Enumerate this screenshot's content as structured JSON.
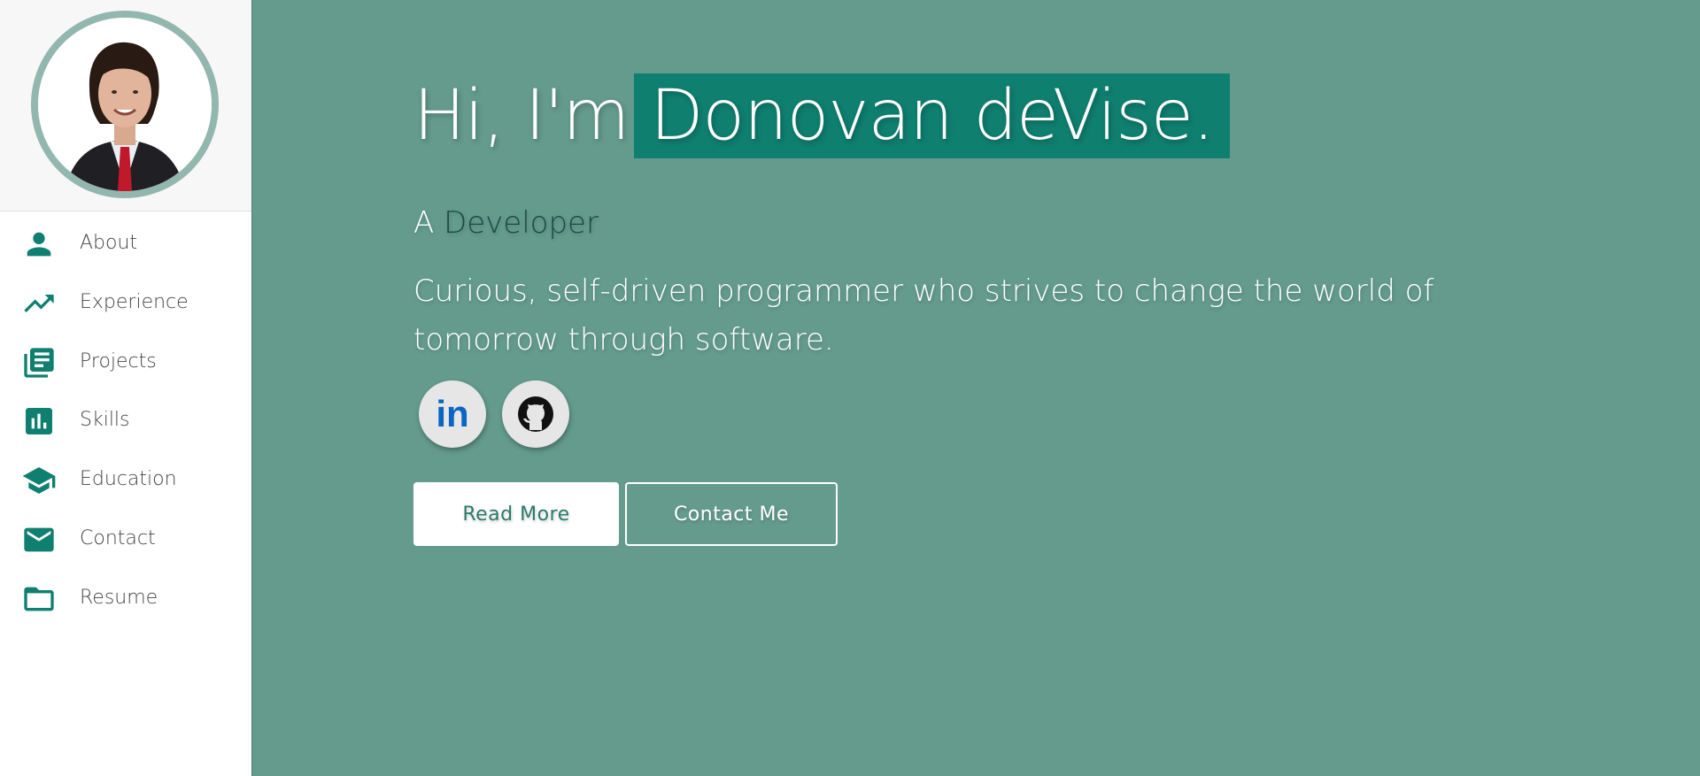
{
  "sidebar": {
    "items": [
      {
        "label": "About",
        "icon": "person-icon"
      },
      {
        "label": "Experience",
        "icon": "trending-up-icon"
      },
      {
        "label": "Projects",
        "icon": "library-books-icon"
      },
      {
        "label": "Skills",
        "icon": "bar-chart-icon"
      },
      {
        "label": "Education",
        "icon": "graduation-cap-icon"
      },
      {
        "label": "Contact",
        "icon": "mail-icon"
      },
      {
        "label": "Resume",
        "icon": "folder-icon"
      }
    ]
  },
  "hero": {
    "greeting": "Hi, I'm",
    "name": "Donovan deVise.",
    "role_prefix": "A",
    "role": "Developer",
    "tagline": "Curious, self-driven programmer who strives to change the world of tomorrow through software."
  },
  "social": {
    "linkedin_label": "in",
    "github_icon": "github-icon"
  },
  "buttons": {
    "read_more": "Read More",
    "contact_me": "Contact Me"
  },
  "colors": {
    "accent": "#0f7f70",
    "background": "#649b8d",
    "sidebar_bg": "#ffffff",
    "icon": "#0f7f70",
    "linkedin": "#0a66c2",
    "avatar_border": "#93b7ae"
  }
}
